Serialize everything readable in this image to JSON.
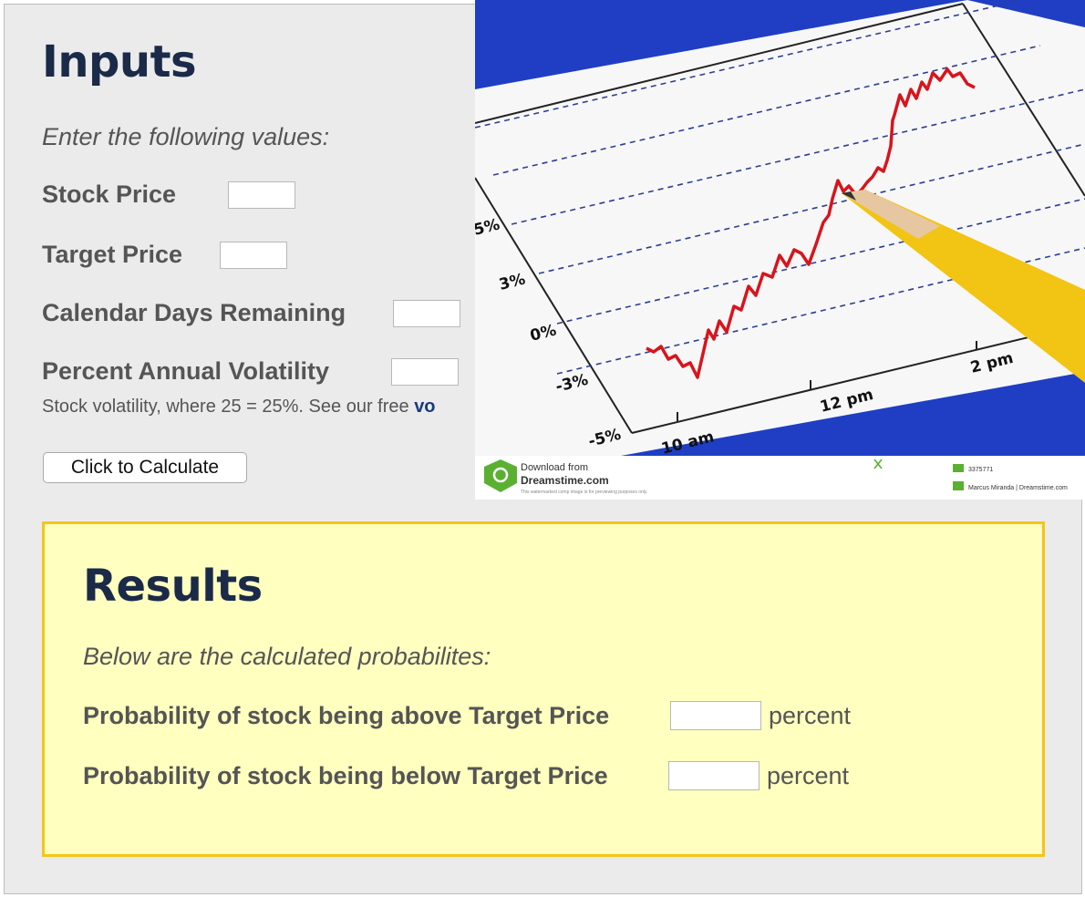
{
  "inputs": {
    "title": "Inputs",
    "subtitle": "Enter the following values:",
    "fields": [
      {
        "label": "Stock Price",
        "value": ""
      },
      {
        "label": "Target Price",
        "value": ""
      },
      {
        "label": "Calendar Days Remaining",
        "value": ""
      },
      {
        "label": "Percent Annual Volatility",
        "value": ""
      }
    ],
    "volatility_note": "Stock volatility, where 25 = 25%. See our free ",
    "volatility_link": "vo",
    "calculate_button": "Click to Calculate"
  },
  "photo": {
    "y_ticks": [
      "5%",
      "3%",
      "0%",
      "-3%",
      "-5%"
    ],
    "x_ticks": [
      "10 am",
      "12 pm",
      "2 pm"
    ],
    "download_from": "Download from",
    "site": "Dreamstime.com",
    "fine_print": "This watermarked comp image is for previewing purposes only.",
    "image_id": "3375771",
    "credit": "Marcus Miranda | Dreamstime.com",
    "colors": {
      "backdrop": "#1f3ec4",
      "line": "#d8141c",
      "pencil": "#f2c413"
    }
  },
  "results": {
    "title": "Results",
    "subtitle": "Below are the calculated probabilites:",
    "above_label": "Probability of stock being above Target Price",
    "above_value": "",
    "below_label": "Probability of stock being below Target Price",
    "below_value": "",
    "unit": "percent"
  },
  "colors": {
    "heading": "#1a2a48",
    "results_bg": "#ffffc0",
    "results_border": "#f5c518"
  }
}
